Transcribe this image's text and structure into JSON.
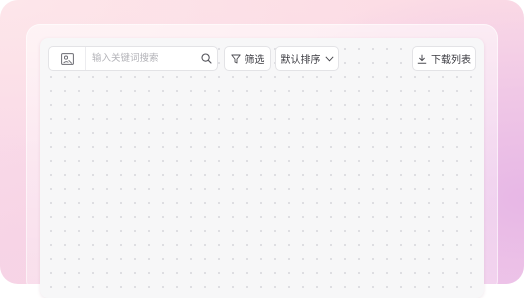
{
  "toolbar": {
    "search": {
      "placeholder": "输入关键词搜索",
      "value": "",
      "image_search_icon": "image-search-icon",
      "submit_icon": "search-icon"
    },
    "filter": {
      "label": "筛选",
      "icon": "filter-icon"
    },
    "sort": {
      "label": "默认排序",
      "icon": "chevron-down-icon"
    },
    "download": {
      "label": "下载列表",
      "icon": "download-icon"
    }
  },
  "colors": {
    "panel_background": "#f7f7f8",
    "border": "#e3e3e6",
    "text": "#3a3a40",
    "placeholder": "#b3b3b8",
    "backdrop_pink": "#fcdde5",
    "backdrop_purple": "#e7b7e6"
  }
}
